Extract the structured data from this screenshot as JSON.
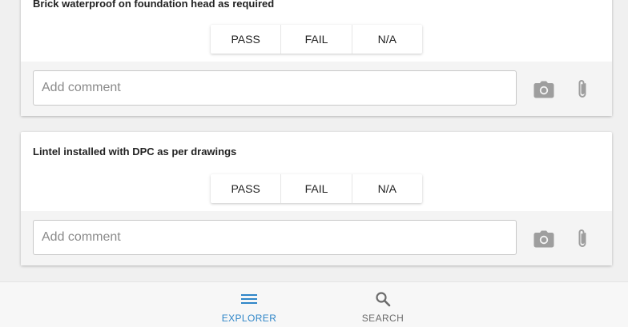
{
  "checklist": [
    {
      "title": "Brick waterproof on foundation head as required",
      "options": [
        "PASS",
        "FAIL",
        "N/A"
      ],
      "comment_placeholder": "Add comment",
      "comment_value": ""
    },
    {
      "title": "Lintel installed with DPC as per drawings",
      "options": [
        "PASS",
        "FAIL",
        "N/A"
      ],
      "comment_placeholder": "Add comment",
      "comment_value": ""
    }
  ],
  "nav": {
    "explorer_label": "EXPLORER",
    "search_label": "SEARCH",
    "active": "explorer"
  },
  "icons": {
    "camera": "camera-icon",
    "attach": "paperclip-icon",
    "explorer": "menu-icon",
    "search": "search-icon"
  },
  "colors": {
    "accent": "#2f86c8",
    "icon_gray": "#9e9e9e",
    "inactive_nav": "#6b6b6b"
  }
}
